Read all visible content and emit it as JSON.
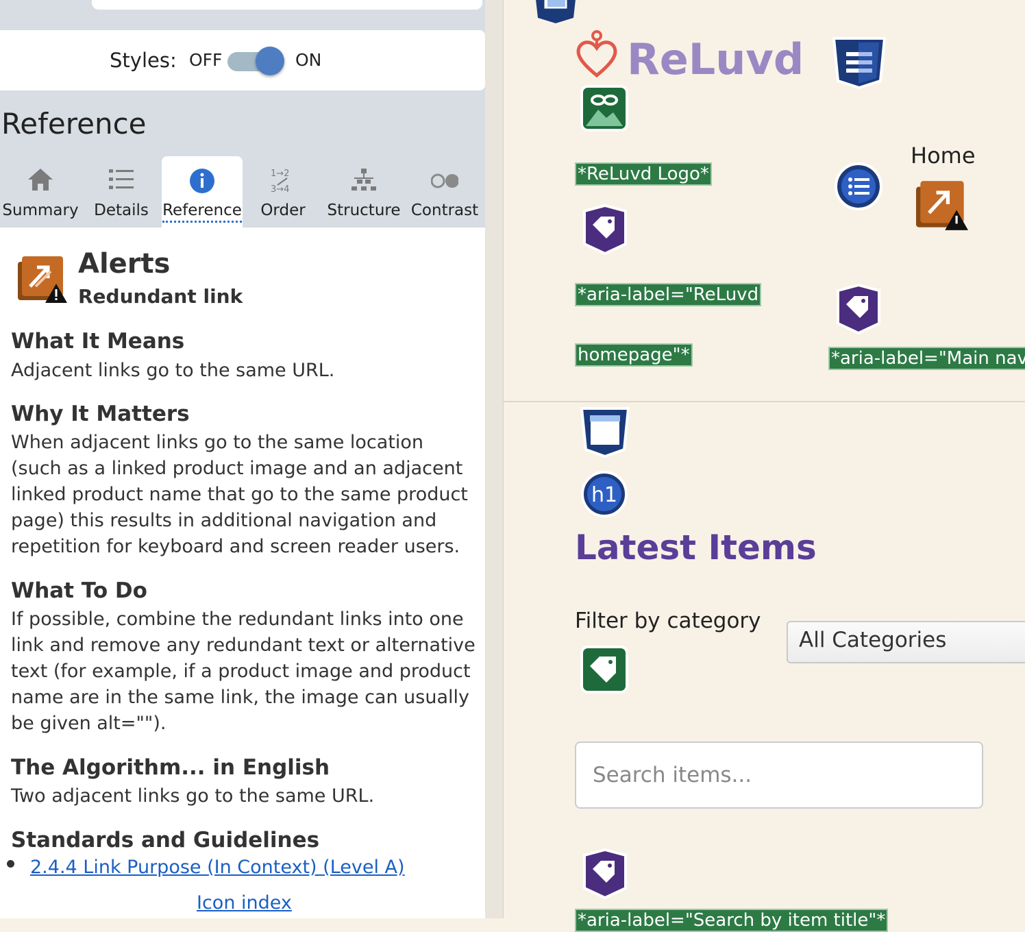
{
  "panel": {
    "styles_label": "Styles:",
    "styles_off": "OFF",
    "styles_on": "ON",
    "styles_state": true,
    "heading": "Reference",
    "tabs": [
      {
        "label": "Summary",
        "icon": "home-icon",
        "active": false
      },
      {
        "label": "Details",
        "icon": "list-icon",
        "active": false
      },
      {
        "label": "Reference",
        "icon": "info-icon",
        "active": true
      },
      {
        "label": "Order",
        "icon": "order-icon",
        "active": false
      },
      {
        "label": "Structure",
        "icon": "structure-icon",
        "active": false
      },
      {
        "label": "Contrast",
        "icon": "contrast-icon",
        "active": false
      }
    ],
    "alert_title": "Alerts",
    "alert_subtitle": "Redundant link",
    "sections": [
      {
        "heading": "What It Means",
        "text": "Adjacent links go to the same URL."
      },
      {
        "heading": "Why It Matters",
        "text": "When adjacent links go to the same location (such as a linked product image and an adjacent linked product name that go to the same product page) this results in additional navigation and repetition for keyboard and screen reader users."
      },
      {
        "heading": "What To Do",
        "text": "If possible, combine the redundant links into one link and remove any redundant text or alternative text (for example, if a product image and product name are in the same link, the image can usually be given alt=\"\")."
      },
      {
        "heading": "The Algorithm... in English",
        "text": "Two adjacent links go to the same URL."
      },
      {
        "heading": "Standards and Guidelines",
        "text": ""
      }
    ],
    "standard_link": "2.4.4 Link Purpose (In Context) (Level A)",
    "icon_index": "Icon index"
  },
  "page": {
    "logo_text": "ReLuvd",
    "labels": {
      "logo_alt": "*ReLuvd Logo*",
      "aria_logo_1": "*aria-label=\"ReLuvd",
      "aria_logo_2": "homepage\"*",
      "aria_nav": "*aria-label=\"Main navig",
      "aria_search": "*aria-label=\"Search by item title\"*"
    },
    "nav_home": "Home",
    "heading_badge": "h1",
    "latest_heading": "Latest Items",
    "filter_label": "Filter by category",
    "filter_value": "All Categories",
    "search_placeholder": "Search items..."
  },
  "colors": {
    "panel_bg": "#d7dde2",
    "page_bg": "#f8f1e6",
    "accent_blue": "#1a5fc4",
    "label_green": "#2d7a45",
    "heading_purple": "#5a3e98",
    "alert_orange": "#c46a24"
  }
}
